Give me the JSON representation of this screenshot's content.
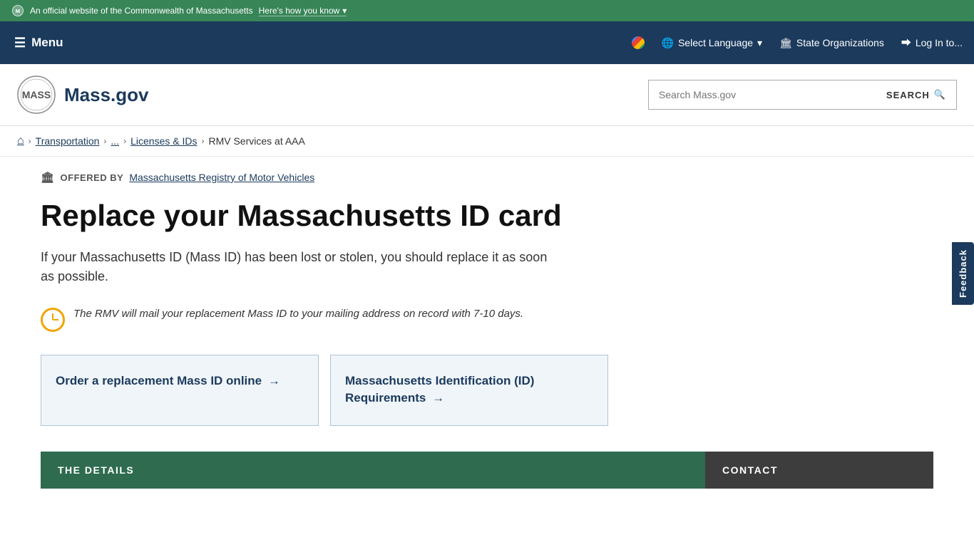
{
  "govBar": {
    "officialText": "An official website of the Commonwealth of Massachusetts",
    "heresHowLink": "Here's how you know"
  },
  "navBar": {
    "menuLabel": "Menu",
    "selectLanguage": "Select Language",
    "stateOrganizations": "State Organizations",
    "logIn": "Log In to..."
  },
  "header": {
    "logoText": "Mass.gov",
    "searchPlaceholder": "Search Mass.gov",
    "searchButtonLabel": "SEARCH"
  },
  "breadcrumb": {
    "home": "⌂",
    "transportation": "Transportation",
    "ellipsis": "...",
    "licensesIds": "Licenses & IDs",
    "rmvServices": "RMV Services at AAA"
  },
  "offeredBy": {
    "label": "OFFERED BY",
    "org": "Massachusetts Registry of Motor Vehicles"
  },
  "page": {
    "title": "Replace your Massachusetts ID card",
    "intro": "If your Massachusetts ID (Mass ID) has been lost or stolen, you should replace it as soon as possible.",
    "notice": "The RMV will mail your replacement Mass ID to your mailing address on record with 7-10 days."
  },
  "cards": [
    {
      "id": "card-order",
      "text": "Order a replacement Mass ID online",
      "arrow": "→"
    },
    {
      "id": "card-requirements",
      "text": "Massachusetts Identification (ID) Requirements",
      "arrow": "→"
    }
  ],
  "bottomSections": {
    "details": "THE DETAILS",
    "contact": "CONTACT"
  },
  "feedback": {
    "label": "Feedback"
  }
}
